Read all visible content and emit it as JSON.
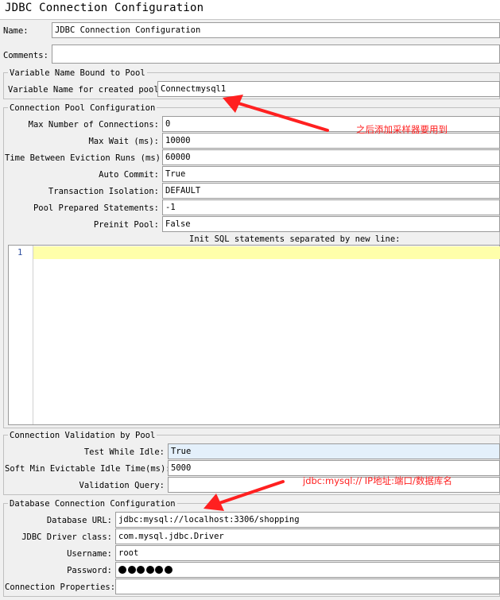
{
  "window": {
    "title": "JDBC Connection Configuration"
  },
  "main": {
    "name_label": "Name:",
    "name_value": "JDBC Connection Configuration",
    "comments_label": "Comments:",
    "comments_value": ""
  },
  "variable_group": {
    "legend": "Variable Name Bound to Pool",
    "label": "Variable Name for created pool:",
    "value": "Connectmysql1"
  },
  "pool_group": {
    "legend": "Connection Pool Configuration",
    "rows": [
      {
        "label": "Max Number of Connections:",
        "value": "0"
      },
      {
        "label": "Max Wait (ms):",
        "value": "10000"
      },
      {
        "label": "Time Between Eviction Runs (ms):",
        "value": "60000"
      },
      {
        "label": "Auto Commit:",
        "value": "True"
      },
      {
        "label": "Transaction Isolation:",
        "value": "DEFAULT"
      },
      {
        "label": "Pool Prepared Statements:",
        "value": "-1"
      },
      {
        "label": "Preinit Pool:",
        "value": "False"
      }
    ],
    "init_sql_label": "Init SQL statements separated by new line:",
    "editor_line_number": "1"
  },
  "validation_group": {
    "legend": "Connection Validation by Pool",
    "rows": [
      {
        "label": "Test While Idle:",
        "value": "True"
      },
      {
        "label": "Soft Min Evictable Idle Time(ms):",
        "value": "5000"
      },
      {
        "label": "Validation Query:",
        "value": ""
      }
    ]
  },
  "database_group": {
    "legend": "Database Connection Configuration",
    "rows": [
      {
        "label": "Database URL:",
        "value": "jdbc:mysql://localhost:3306/shopping"
      },
      {
        "label": "JDBC Driver class:",
        "value": "com.mysql.jdbc.Driver"
      },
      {
        "label": "Username:",
        "value": "root"
      },
      {
        "label": "Password:",
        "value": "",
        "masked_dots": 6
      },
      {
        "label": "Connection Properties:",
        "value": ""
      }
    ]
  },
  "annotations": {
    "note_pool": "之后添加采样器要用到",
    "note_url": "jdbc:mysql:// IP地址:端口/数据库名",
    "color": "#ff2020"
  }
}
